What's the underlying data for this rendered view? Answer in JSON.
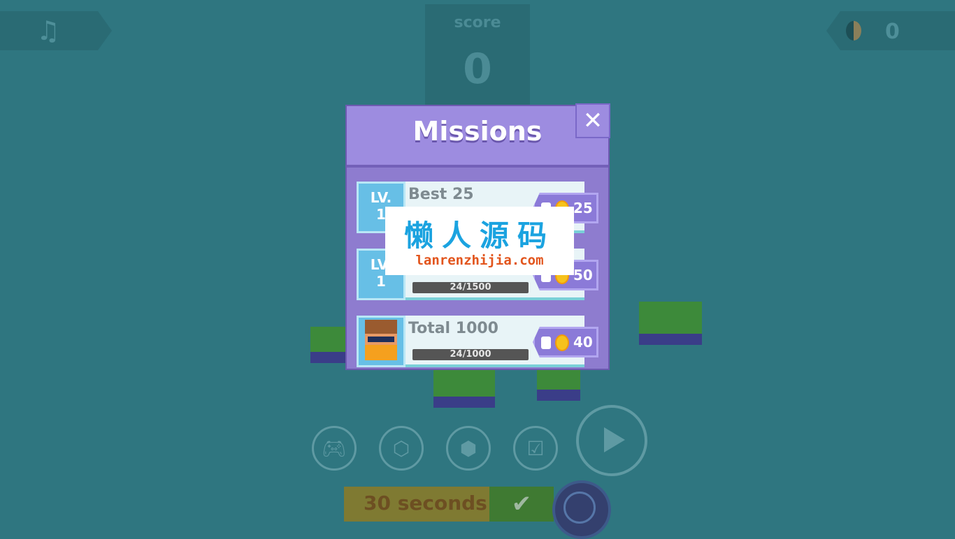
{
  "hud": {
    "music_icon": "music-note-icon",
    "score_label": "score",
    "score_value": "0",
    "coin_count": "0"
  },
  "missions": {
    "title": "Missions",
    "close_symbol": "✕",
    "rows": [
      {
        "level_label": "LV.",
        "level": "1",
        "title": "Best 25",
        "progress_text": "",
        "reward": "25"
      },
      {
        "level_label": "LV.",
        "level": "1",
        "title": "",
        "progress_text": "24/1500",
        "progress": 0.016,
        "reward": "50"
      },
      {
        "level_label": "",
        "level": "",
        "title": "Total 1000",
        "progress_text": "24/1000",
        "progress": 0.024,
        "reward": "40"
      }
    ]
  },
  "controls": {
    "buttons": [
      "gamepad-icon",
      "platform-icon",
      "character-cube-icon",
      "clipboard-check-icon"
    ],
    "timer_label": "30 seconds",
    "check_symbol": "✔"
  },
  "watermark": {
    "title": "懒人源码",
    "url": "lanrenzhijia.com"
  },
  "colors": {
    "background": "#2f7680",
    "modal": "#8e7ccf",
    "level_box": "#67bfe6",
    "coin": "#f6c21c"
  }
}
